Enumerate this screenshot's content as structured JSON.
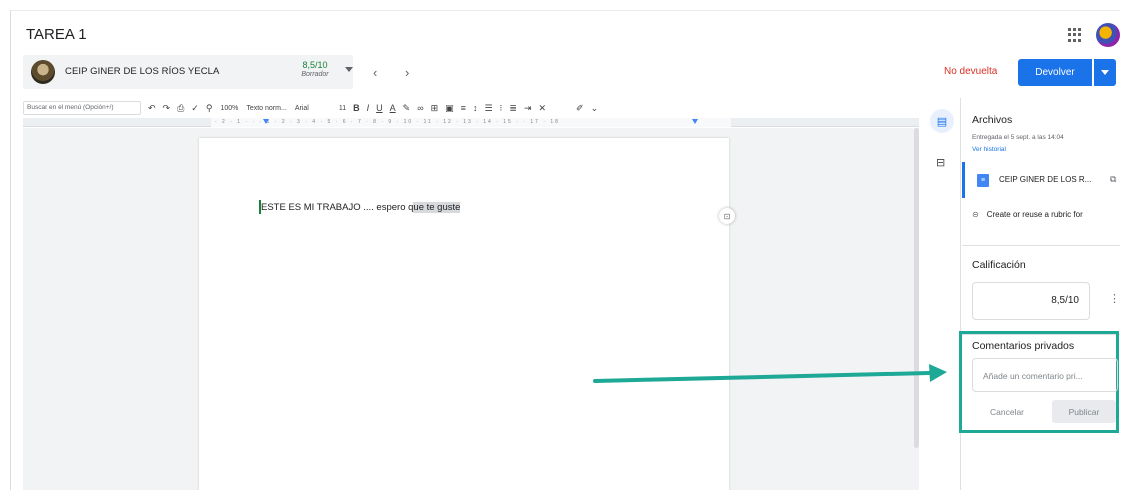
{
  "header": {
    "title": "TAREA 1"
  },
  "student": {
    "name": "CEIP GINER DE LOS RÍOS YECLA",
    "grade": "8,5/10",
    "grade_status": "Borrador"
  },
  "nav": {
    "prev": "‹",
    "next": "›"
  },
  "actions": {
    "status": "No devuelta",
    "return_label": "Devolver"
  },
  "toolbar": {
    "menu_search": "Buscar en el menú (Opción+/)",
    "zoom": "100%",
    "style": "Texto norm...",
    "font": "Arial",
    "font_size": "11"
  },
  "ruler": {
    "marks": "· 2 · 1 · · · 1 · 2 · 3 · 4 · 5 · 6 · 7 · 8 · 9 · 10 · 11 · 12 · 13 · 14 · 15 · · 17 · 18"
  },
  "document": {
    "text_before": "ESTE ES MI TRABAJO .... espero q",
    "text_highlighted": "ue te guste"
  },
  "panel": {
    "files_title": "Archivos",
    "delivered": "Entregada el 5 sept. a las 14:04",
    "history_link": "Ver historial",
    "file_name": "CEIP GINER DE LOS R...",
    "rubric": "Create or reuse a rubric for",
    "grade_title": "Calificación",
    "grade_value": "8,5/10",
    "comments_title": "Comentarios privados",
    "comment_placeholder": "Añade un comentario pri...",
    "cancel_label": "Cancelar",
    "publish_label": "Publicar"
  },
  "colors": {
    "accent": "#1a73e8",
    "status_red": "#d93025",
    "grade_green": "#188038",
    "annotation_teal": "#1ea896"
  }
}
